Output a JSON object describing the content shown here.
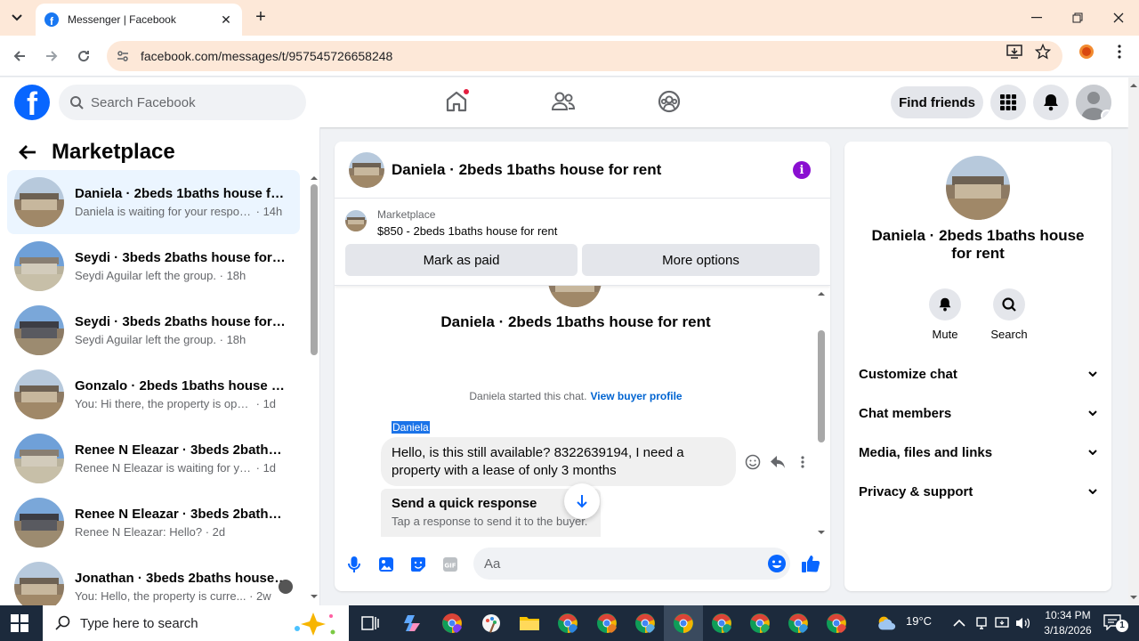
{
  "browser": {
    "tab_title": "Messenger | Facebook",
    "url": "facebook.com/messages/t/957545726658248"
  },
  "fb_header": {
    "search_placeholder": "Search Facebook",
    "find_friends_label": "Find friends"
  },
  "sidebar": {
    "title": "Marketplace",
    "conversations": [
      {
        "name": "Daniela · 2beds 1baths house for rent",
        "preview": "Daniela is waiting for your respon...",
        "time": "14h",
        "active": true
      },
      {
        "name": "Seydi · 3beds 2baths house for rent",
        "preview": "Seydi Aguilar left the group.",
        "time": "18h"
      },
      {
        "name": "Seydi · 3beds 2baths house for rent",
        "preview": "Seydi Aguilar left the group.",
        "time": "18h"
      },
      {
        "name": "Gonzalo · 2beds 1baths house for rent",
        "preview": "You: Hi there, the property is open ...",
        "time": "1d"
      },
      {
        "name": "Renee N Eleazar · 3beds 2baths house for rent",
        "preview": "Renee N Eleazar is waiting for your ...",
        "time": "1d"
      },
      {
        "name": "Renee N Eleazar · 3beds 2baths house for rent",
        "preview": "Renee N Eleazar: Hello?",
        "time": "2d"
      },
      {
        "name": "Jonathan · 3beds 2baths house for rent",
        "preview": "You: Hello, the property is curre...",
        "time": "2w"
      }
    ]
  },
  "chat": {
    "title": "Daniela · 2beds 1baths house for rent",
    "listing_source": "Marketplace",
    "listing_price": "$850 - 2beds 1baths house for rent",
    "mark_paid_label": "Mark as paid",
    "more_options_label": "More options",
    "thread_title": "Daniela · 2beds 1baths house for rent",
    "started_text": "Daniela started this chat.",
    "view_buyer_label": "View buyer profile",
    "sender_name": "Daniela",
    "message_text": "Hello, is this still available? 8322639194, I need a property with a lease of only 3 months",
    "quick_title": "Send a quick response",
    "quick_sub": "Tap a response to send it to the buyer.",
    "composer_placeholder": "Aa"
  },
  "info_panel": {
    "name": "Daniela · 2beds 1baths house for rent",
    "mute_label": "Mute",
    "search_label": "Search",
    "sections": [
      "Customize chat",
      "Chat members",
      "Media, files and links",
      "Privacy & support"
    ]
  },
  "taskbar": {
    "search_placeholder": "Type here to search",
    "weather": "19°C",
    "time": "10:34 PM",
    "date": "3/18/2026",
    "notification_count": "1"
  },
  "colors": {
    "fb_blue": "#0866ff",
    "messenger_purple": "#8a0fd1",
    "link_blue": "#0064d1",
    "active_conv_bg": "#ebf5ff"
  }
}
